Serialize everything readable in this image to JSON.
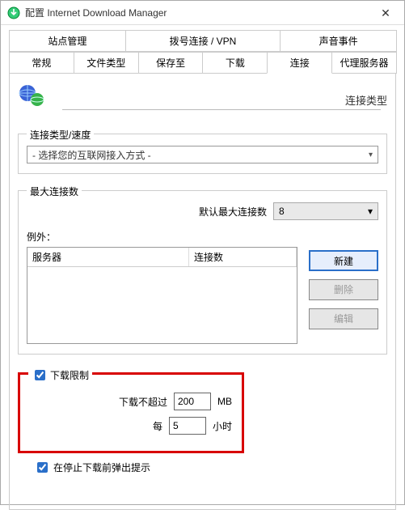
{
  "window": {
    "title": "配置 Internet Download Manager"
  },
  "tabs_row1": [
    "站点管理",
    "拨号连接 / VPN",
    "声音事件"
  ],
  "tabs_row2": [
    "常规",
    "文件类型",
    "保存至",
    "下载",
    "连接",
    "代理服务器"
  ],
  "active_tab": "连接",
  "panel": {
    "header_label": "连接类型",
    "group_type": {
      "legend": "连接类型/速度",
      "combo_value": "- 选择您的互联网接入方式 -"
    },
    "group_max": {
      "legend": "最大连接数",
      "default_label": "默认最大连接数",
      "default_value": "8",
      "except_label": "例外：",
      "th_server": "服务器",
      "th_conn": "连接数",
      "btn_new": "新建",
      "btn_del": "删除",
      "btn_edit": "编辑"
    },
    "group_limit": {
      "legend": "下载限制",
      "dl_label": "下载不超过",
      "dl_value": "200",
      "dl_unit": "MB",
      "per_label": "每",
      "per_value": "5",
      "per_unit": "小时"
    },
    "popup_chk_label": "在停止下载前弹出提示"
  }
}
